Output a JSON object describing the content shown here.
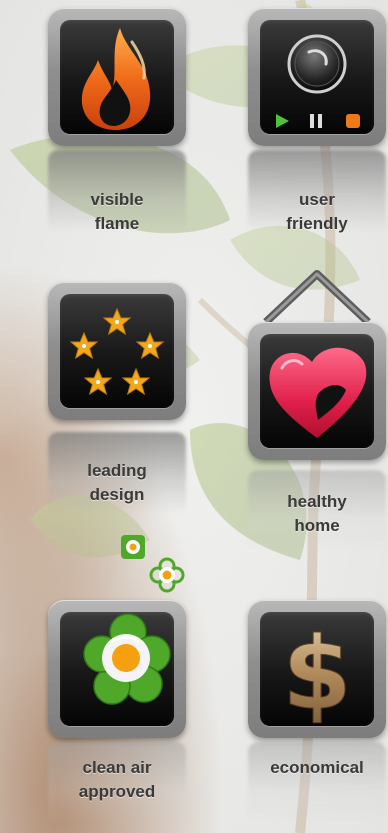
{
  "features": [
    {
      "id": "visible-flame",
      "line1": "visible",
      "line2": "flame",
      "icon": "flame-icon"
    },
    {
      "id": "user-friendly",
      "line1": "user",
      "line2": "friendly",
      "icon": "control-panel-icon"
    },
    {
      "id": "leading-design",
      "line1": "leading",
      "line2": "design",
      "icon": "stars-icon"
    },
    {
      "id": "healthy-home",
      "line1": "healthy",
      "line2": "home",
      "icon": "heart-icon"
    },
    {
      "id": "clean-air-approved",
      "line1": "clean air",
      "line2": "approved",
      "icon": "flower-icon"
    },
    {
      "id": "economical",
      "line1": "economical",
      "line2": "",
      "icon": "dollar-icon"
    }
  ],
  "colors": {
    "flame": "#f06a1a",
    "heart": "#e0204a",
    "star": "#f2a81d",
    "flower_green": "#4fa82a",
    "flower_center": "#f5a010",
    "dollar": "#b08a5a",
    "play": "#4cc33a",
    "stop": "#f07a18"
  }
}
